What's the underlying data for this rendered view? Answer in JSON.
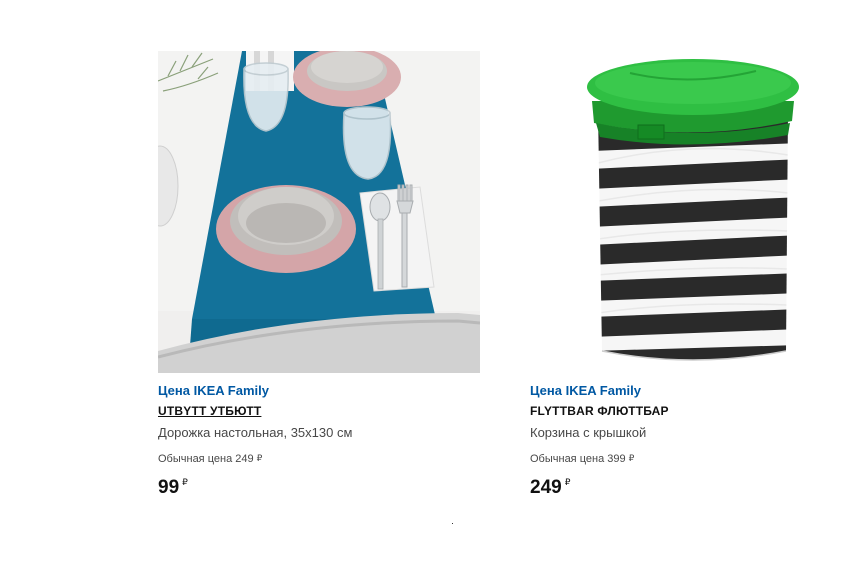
{
  "products": [
    {
      "family_label": "Цена IKEA Family",
      "name": "UTBYTT УТБЮТТ",
      "description": "Дорожка настольная, 35x130 см",
      "regular_price_label": "Обычная цена 249",
      "regular_price_currency": "₽",
      "price": "99",
      "price_currency": "₽",
      "image_icon": "table-runner-photo"
    },
    {
      "family_label": "Цена IKEA Family",
      "name": "FLYTTBAR ФЛЮТТБАР",
      "description": "Корзина с крышкой",
      "regular_price_label": "Обычная цена 399",
      "regular_price_currency": "₽",
      "price": "249",
      "price_currency": "₽",
      "image_icon": "striped-laundry-basket-photo"
    }
  ],
  "colors": {
    "family_label": "#0058a3",
    "runner_blue": "#13729a",
    "lid_green": "#27b53a"
  }
}
